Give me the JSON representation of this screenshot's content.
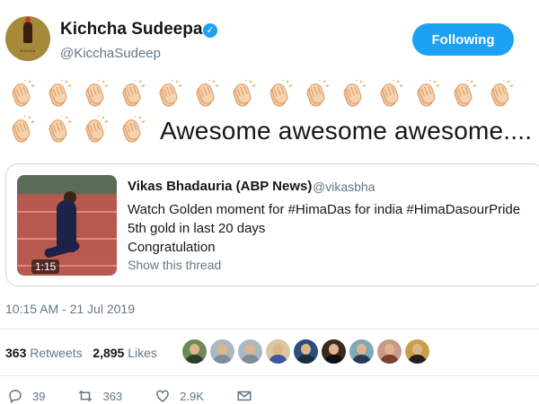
{
  "author": {
    "name": "Kichcha Sudeepa",
    "handle": "@KicchaSudeep",
    "avatar_caption": "KICCHA",
    "verified": true
  },
  "follow_button": {
    "label": "Following",
    "color": "#1da1f2"
  },
  "tweet": {
    "clap_count_row1": 14,
    "clap_count_row2": 4,
    "text": "Awesome awesome awesome...."
  },
  "quoted_tweet": {
    "author_name": "Vikas Bhadauria (ABP News)",
    "author_handle": "@vikasbha",
    "lines": [
      "Watch Golden moment for #HimaDas for india #HimaDasourPride",
      "5th gold in last 20 days",
      "Congratulation"
    ],
    "video_duration": "1:15",
    "show_thread": "Show this thread"
  },
  "timestamp": "10:15 AM - 21 Jul 2019",
  "stats": {
    "retweets_count": "363",
    "retweets_label": "Retweets",
    "likes_count": "2,895",
    "likes_label": "Likes"
  },
  "likers": [
    {
      "icon": "liker-avatar-1",
      "bg": "#6b8a5a",
      "body": "#2d3e2a"
    },
    {
      "icon": "liker-avatar-2",
      "bg": "#aab8c2",
      "body": "#7f8c96"
    },
    {
      "icon": "liker-avatar-3",
      "bg": "#aab8c2",
      "body": "#7f8c96"
    },
    {
      "icon": "liker-avatar-4",
      "bg": "#d9c7a0",
      "body": "#3b5998"
    },
    {
      "icon": "liker-avatar-5",
      "bg": "#2b4f7a",
      "body": "#1b2b40"
    },
    {
      "icon": "liker-avatar-6",
      "bg": "#3a2a20",
      "body": "#101010"
    },
    {
      "icon": "liker-avatar-7",
      "bg": "#7fa8b8",
      "body": "#2a3a50"
    },
    {
      "icon": "liker-avatar-8",
      "bg": "#c79a8a",
      "body": "#7a4030"
    },
    {
      "icon": "liker-avatar-9",
      "bg": "#c7a14a",
      "body": "#202020"
    }
  ],
  "actions": {
    "replies": "39",
    "retweets": "363",
    "likes": "2.9K"
  }
}
